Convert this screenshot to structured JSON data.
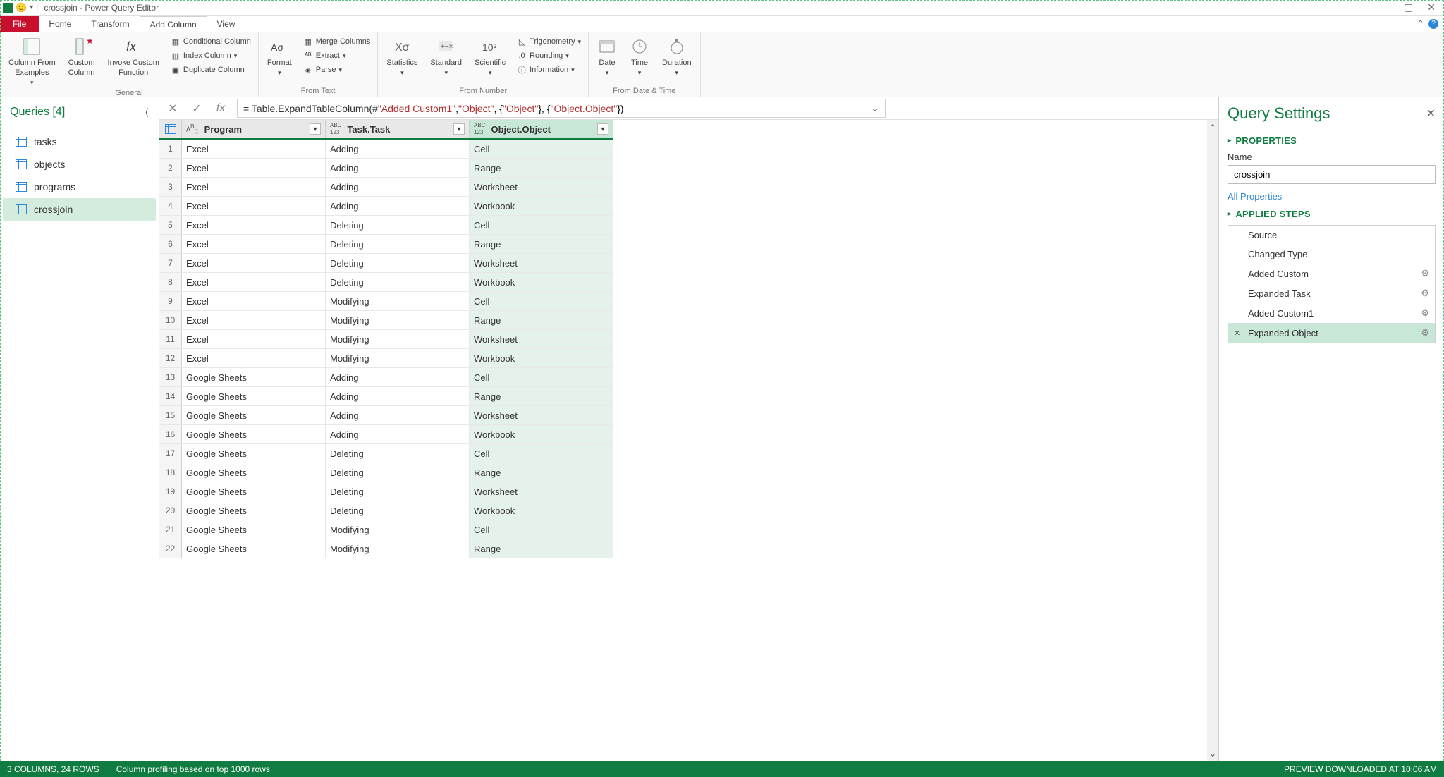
{
  "title": "crossjoin - Power Query Editor",
  "ribbon_tabs": [
    "File",
    "Home",
    "Transform",
    "Add Column",
    "View"
  ],
  "ribbon": {
    "general": {
      "label": "General",
      "column_from_examples": "Column From\nExamples",
      "custom_column": "Custom\nColumn",
      "invoke_custom": "Invoke Custom\nFunction",
      "conditional": "Conditional Column",
      "index": "Index Column",
      "duplicate": "Duplicate Column"
    },
    "from_text": {
      "label": "From Text",
      "format": "Format",
      "merge": "Merge Columns",
      "extract": "Extract",
      "parse": "Parse"
    },
    "from_number": {
      "label": "From Number",
      "statistics": "Statistics",
      "standard": "Standard",
      "scientific": "Scientific",
      "trig": "Trigonometry",
      "rounding": "Rounding",
      "info": "Information"
    },
    "from_dt": {
      "label": "From Date & Time",
      "date": "Date",
      "time": "Time",
      "duration": "Duration"
    }
  },
  "queries": {
    "header": "Queries [4]",
    "items": [
      "tasks",
      "objects",
      "programs",
      "crossjoin"
    ],
    "active_index": 3
  },
  "formula": {
    "prefix": "= Table.ExpandTableColumn(#",
    "arg1": "\"Added Custom1\"",
    "arg2": "\"Object\"",
    "arg3": "\"Object\"",
    "arg4": "\"Object.Object\""
  },
  "grid": {
    "columns": [
      {
        "name": "Program",
        "type": "ABC"
      },
      {
        "name": "Task.Task",
        "type": "ABC123"
      },
      {
        "name": "Object.Object",
        "type": "ABC123"
      }
    ],
    "selected_col": 2,
    "rows": [
      [
        "Excel",
        "Adding",
        "Cell"
      ],
      [
        "Excel",
        "Adding",
        "Range"
      ],
      [
        "Excel",
        "Adding",
        "Worksheet"
      ],
      [
        "Excel",
        "Adding",
        "Workbook"
      ],
      [
        "Excel",
        "Deleting",
        "Cell"
      ],
      [
        "Excel",
        "Deleting",
        "Range"
      ],
      [
        "Excel",
        "Deleting",
        "Worksheet"
      ],
      [
        "Excel",
        "Deleting",
        "Workbook"
      ],
      [
        "Excel",
        "Modifying",
        "Cell"
      ],
      [
        "Excel",
        "Modifying",
        "Range"
      ],
      [
        "Excel",
        "Modifying",
        "Worksheet"
      ],
      [
        "Excel",
        "Modifying",
        "Workbook"
      ],
      [
        "Google Sheets",
        "Adding",
        "Cell"
      ],
      [
        "Google Sheets",
        "Adding",
        "Range"
      ],
      [
        "Google Sheets",
        "Adding",
        "Worksheet"
      ],
      [
        "Google Sheets",
        "Adding",
        "Workbook"
      ],
      [
        "Google Sheets",
        "Deleting",
        "Cell"
      ],
      [
        "Google Sheets",
        "Deleting",
        "Range"
      ],
      [
        "Google Sheets",
        "Deleting",
        "Worksheet"
      ],
      [
        "Google Sheets",
        "Deleting",
        "Workbook"
      ],
      [
        "Google Sheets",
        "Modifying",
        "Cell"
      ],
      [
        "Google Sheets",
        "Modifying",
        "Range"
      ]
    ]
  },
  "settings": {
    "header": "Query Settings",
    "properties": "PROPERTIES",
    "name_label": "Name",
    "name_value": "crossjoin",
    "all_props": "All Properties",
    "applied_steps": "APPLIED STEPS",
    "steps": [
      {
        "label": "Source",
        "gear": false
      },
      {
        "label": "Changed Type",
        "gear": false
      },
      {
        "label": "Added Custom",
        "gear": true
      },
      {
        "label": "Expanded Task",
        "gear": true
      },
      {
        "label": "Added Custom1",
        "gear": true
      },
      {
        "label": "Expanded Object",
        "gear": true
      }
    ],
    "active_step": 5
  },
  "status": {
    "seg1": "3 COLUMNS, 24 ROWS",
    "seg2": "Column profiling based on top 1000 rows",
    "right": "PREVIEW DOWNLOADED AT 10:06 AM"
  }
}
